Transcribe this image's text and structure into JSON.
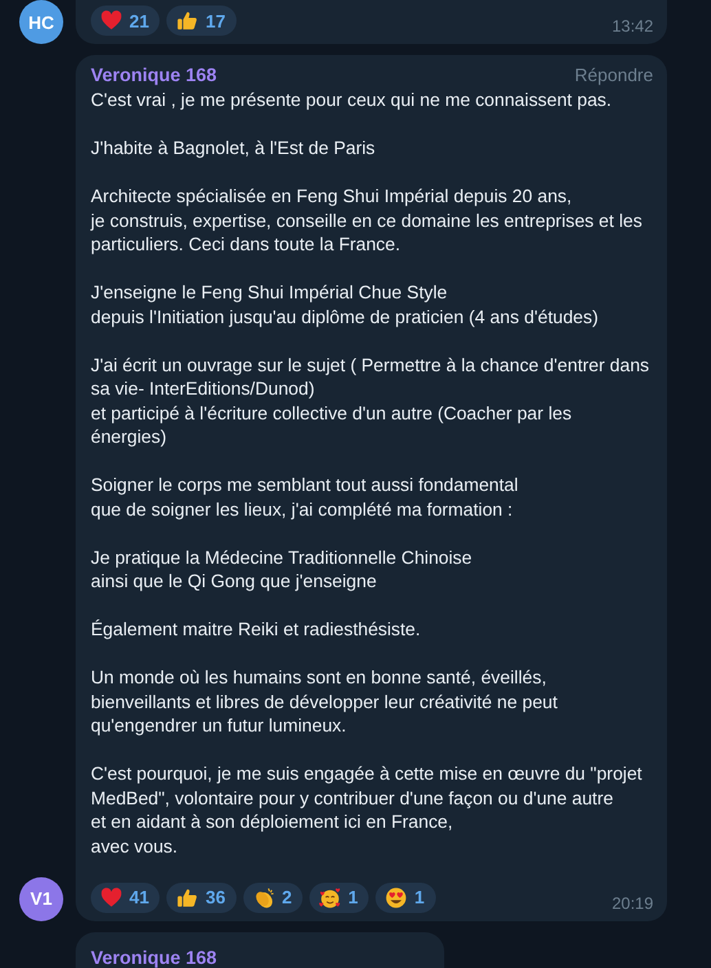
{
  "messages": [
    {
      "avatar": {
        "initials": "HC",
        "color": "#4f9be3"
      },
      "reactions": [
        {
          "kind": "heart",
          "count": "21"
        },
        {
          "kind": "thumbs_up",
          "count": "17"
        }
      ],
      "time": "13:42"
    },
    {
      "avatar": {
        "initials": "V1",
        "color": "#8c76e8"
      },
      "author": "Veronique 168",
      "reply_label": "Répondre",
      "paragraphs": [
        [
          "C'est vrai , je me présente pour ceux qui ne me connaissent pas."
        ],
        [
          "J'habite à Bagnolet, à l'Est de Paris"
        ],
        [
          "Architecte spécialisée en Feng Shui Impérial depuis 20 ans,",
          "je construis, expertise, conseille en ce domaine les entreprises et les",
          "particuliers. Ceci dans toute la France."
        ],
        [
          "J'enseigne le Feng Shui Impérial Chue Style",
          "depuis l'Initiation jusqu'au diplôme de praticien (4 ans d'études)"
        ],
        [
          "J'ai écrit un ouvrage sur le sujet ( Permettre à la chance d'entrer dans",
          "sa vie- InterEditions/Dunod)",
          "et participé à l'écriture collective d'un autre (Coacher par les",
          "énergies)"
        ],
        [
          "Soigner le corps me semblant tout aussi fondamental",
          "que de soigner les lieux, j'ai complété ma formation :"
        ],
        [
          "Je pratique la Médecine Traditionnelle Chinoise",
          "ainsi que le Qi Gong que j'enseigne"
        ],
        [
          "Également maitre Reiki et radiesthésiste."
        ],
        [
          "Un monde où les humains sont en bonne santé, éveillés,",
          "bienveillants et libres de développer leur créativité ne peut",
          "qu'engendrer un futur lumineux."
        ],
        [
          "C'est pourquoi, je me suis engagée à cette mise en œuvre du \"projet",
          "MedBed\", volontaire pour y contribuer d'une façon ou d'une autre",
          "et en aidant à son déploiement ici en France,",
          "avec vous."
        ]
      ],
      "reactions": [
        {
          "kind": "heart",
          "count": "41"
        },
        {
          "kind": "thumbs_up",
          "count": "36"
        },
        {
          "kind": "clap",
          "count": "2"
        },
        {
          "kind": "smiling_hearts",
          "count": "1"
        },
        {
          "kind": "heart_eyes",
          "count": "1"
        }
      ],
      "time": "20:19"
    },
    {
      "author": "Veronique 168"
    }
  ]
}
